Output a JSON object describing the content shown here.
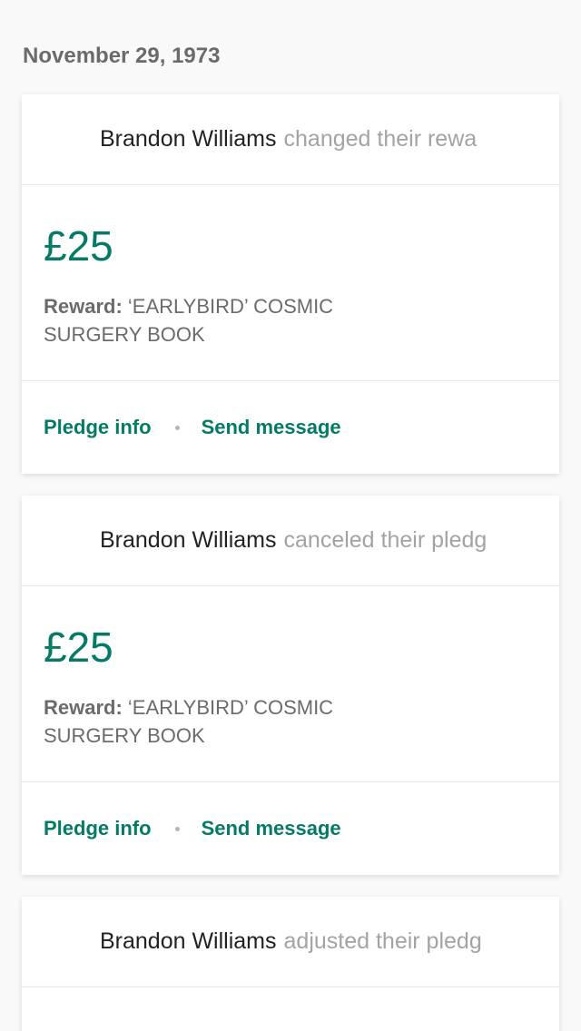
{
  "date_header": "November 29, 1973",
  "cards": [
    {
      "user_name": "Brandon Williams",
      "action": "changed their rewa",
      "amount": "£25",
      "reward_label": "Reward:",
      "reward_text": "‘EARLYBIRD’ COSMIC SURGERY BOOK",
      "pledge_info_label": "Pledge info",
      "send_message_label": "Send message"
    },
    {
      "user_name": "Brandon Williams",
      "action": "canceled their pledg",
      "amount": "£25",
      "reward_label": "Reward:",
      "reward_text": "‘EARLYBIRD’ COSMIC SURGERY BOOK",
      "pledge_info_label": "Pledge info",
      "send_message_label": "Send message"
    },
    {
      "user_name": "Brandon Williams",
      "action": "adjusted their pledg"
    }
  ],
  "colors": {
    "accent": "#057a67",
    "muted_text": "#6b6b6b",
    "light_text": "#a3a3a3",
    "divider": "#e6e6e6",
    "background": "#f9f9f9"
  }
}
